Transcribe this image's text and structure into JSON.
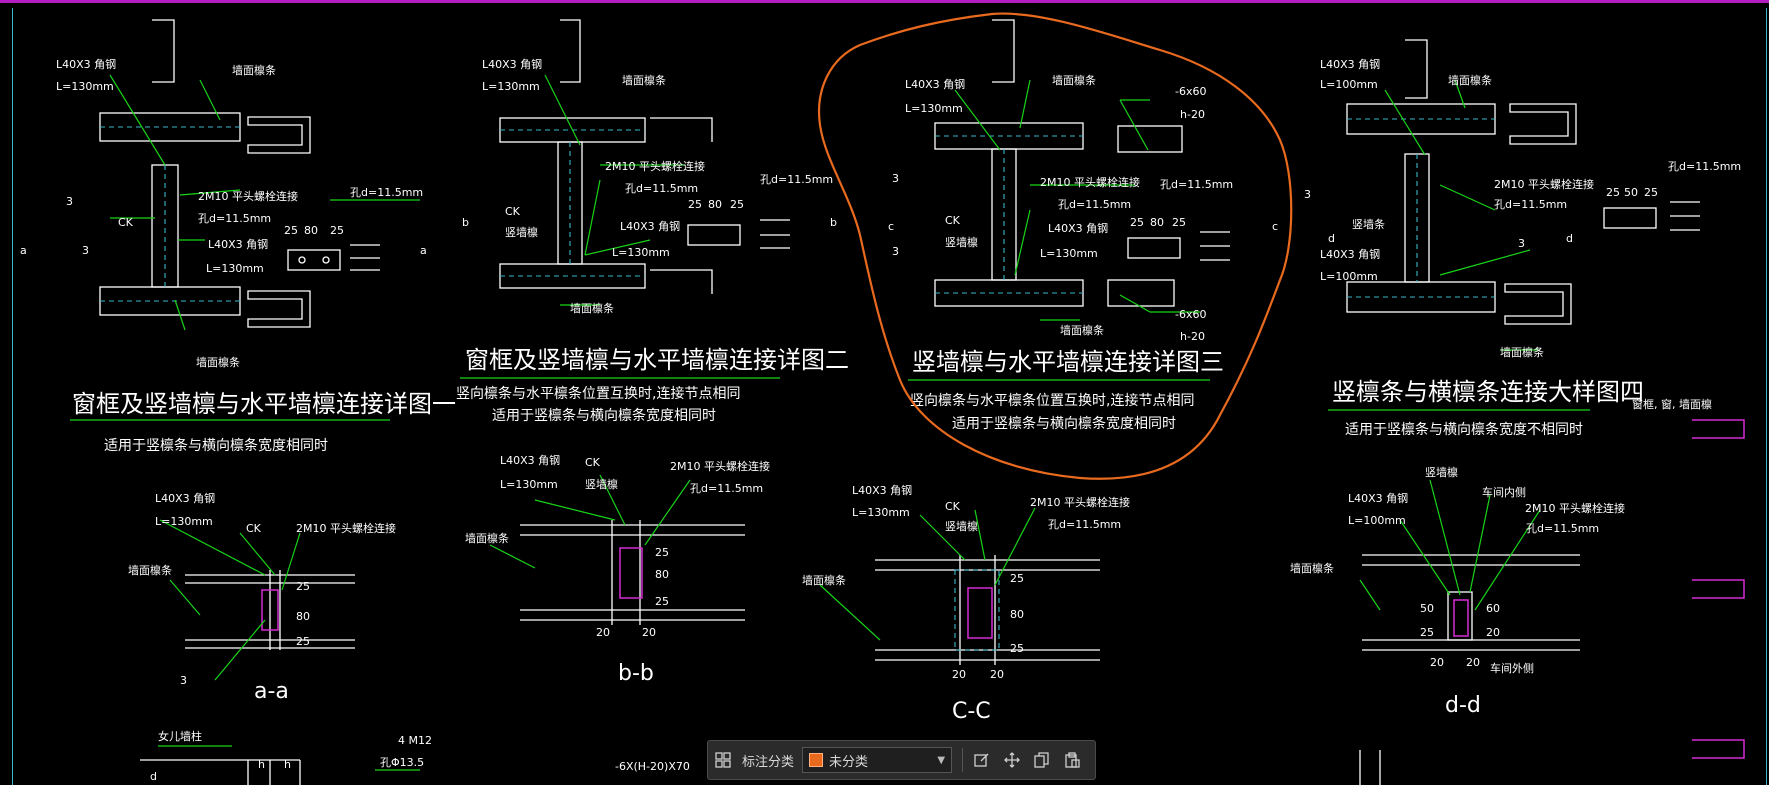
{
  "colors": {
    "background": "#000000",
    "green": "#18d418",
    "white": "#ffffff",
    "cyan": "#3ab7c9",
    "magenta": "#d62ad6",
    "orange": "#e86a1e"
  },
  "labels": {
    "l40x3": "L40X3 角钢",
    "l130": "L=130mm",
    "l100": "L=100mm",
    "wall_purlin": "墙面檩条",
    "vertical_purlin": "竖墙檩",
    "bolt2m10": "2M10 平头螺栓连接",
    "bolt2m10_b": "2M10 平头螺栓连接",
    "hole": "孔d=11.5mm",
    "ck": "CK",
    "tag3": "3",
    "sec_a": "a",
    "sec_b": "b",
    "sec_c": "c",
    "sec_d": "d",
    "dim25": "25",
    "dim80": "80",
    "dim50": "50",
    "dim20": "20",
    "dim60": "60",
    "plate6x60": "-6x60",
    "h20": "h-20",
    "window_frame": "窗框",
    "vertical_purlin2": "竖墙条",
    "car_angle": "车间内侧",
    "car_outer": "车间外侧",
    "parapet": "女儿墙柱",
    "four_m12": "4 M12",
    "hole135": "孔Φ13.5",
    "h": "h",
    "plate_bottom": "-6X(H-20)X70",
    "window_small": "窗框, 窗, 墙面檩"
  },
  "titles": {
    "t1": "窗框及竖墙檩与水平墙檩连接详图一",
    "t1_sub": "适用于竖檩条与横向檩条宽度相同时",
    "t2": "窗框及竖墙檩与水平墙檩连接详图二",
    "t2_sub1": "竖向檩条与水平檩条位置互换时,连接节点相同",
    "t2_sub2": "适用于竖檩条与横向檩条宽度相同时",
    "t3": "竖墙檩与水平墙檩连接详图三",
    "t3_sub1": "竖向檩条与水平檩条位置互换时,连接节点相同",
    "t3_sub2": "适用于竖檩条与横向檩条宽度相同时",
    "t4": "竖檩条与横檩条连接大样图四",
    "t4_sub": "适用于竖檩条与横向檩条宽度不相同时",
    "aa": "a-a",
    "bb": "b-b",
    "cc": "C-C",
    "dd": "d-d"
  },
  "toolbar": {
    "label": "标注分类",
    "selected": "未分类",
    "icons": [
      "grid-icon",
      "edit-icon",
      "move-icon",
      "copy-icon",
      "paste-icon"
    ]
  }
}
